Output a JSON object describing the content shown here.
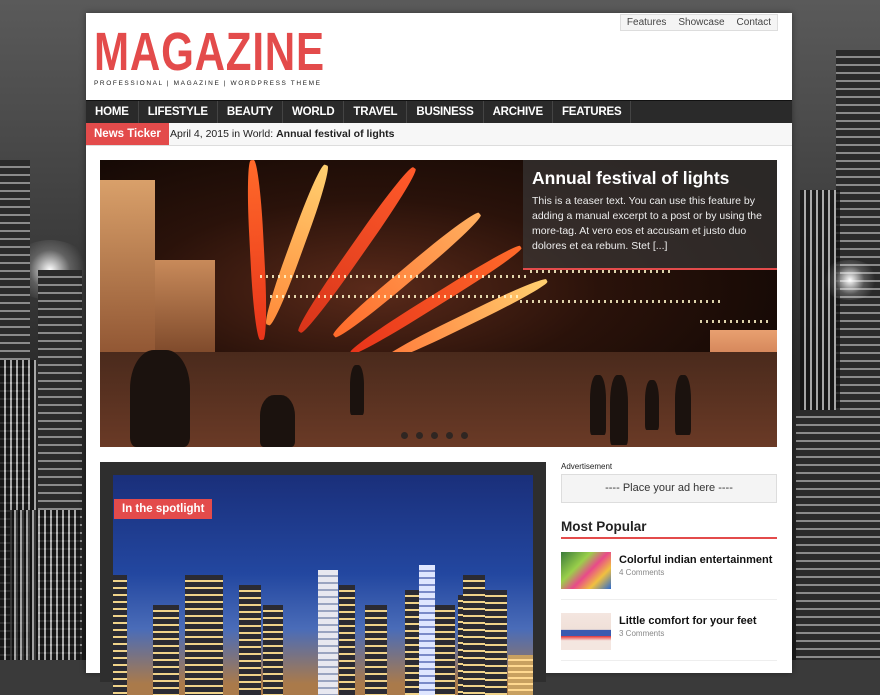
{
  "brand": {
    "title": "MAGAZINE",
    "tagline": "PROFESSIONAL | MAGAZINE | WORDPRESS THEME",
    "accent_color": "#e34b4b"
  },
  "top_nav": [
    {
      "label": "Features"
    },
    {
      "label": "Showcase"
    },
    {
      "label": "Contact"
    }
  ],
  "main_nav": [
    {
      "label": "HOME"
    },
    {
      "label": "LIFESTYLE"
    },
    {
      "label": "BEAUTY"
    },
    {
      "label": "WORLD"
    },
    {
      "label": "TRAVEL"
    },
    {
      "label": "BUSINESS"
    },
    {
      "label": "ARCHIVE"
    },
    {
      "label": "FEATURES"
    }
  ],
  "ticker": {
    "label": "News Ticker",
    "date": "April 4, 2015",
    "in_word": "in",
    "category": "World:",
    "headline": "Annual festival of lights"
  },
  "slider": {
    "title": "Annual festival of lights",
    "excerpt": "This is a teaser text. You can use this feature by adding a manual excerpt to a post or by using the more-tag. At vero eos et accusam et justo duo dolores et ea rebum. Stet [...]",
    "slide_count": 5
  },
  "spotlight": {
    "label": "In the spotlight"
  },
  "sidebar": {
    "ad_label": "Advertisement",
    "ad_placeholder": "---- Place your ad here ----",
    "popular_title": "Most Popular",
    "popular": [
      {
        "title": "Colorful indian entertainment",
        "meta": "4 Comments"
      },
      {
        "title": "Little comfort for your feet",
        "meta": "3 Comments"
      }
    ]
  }
}
